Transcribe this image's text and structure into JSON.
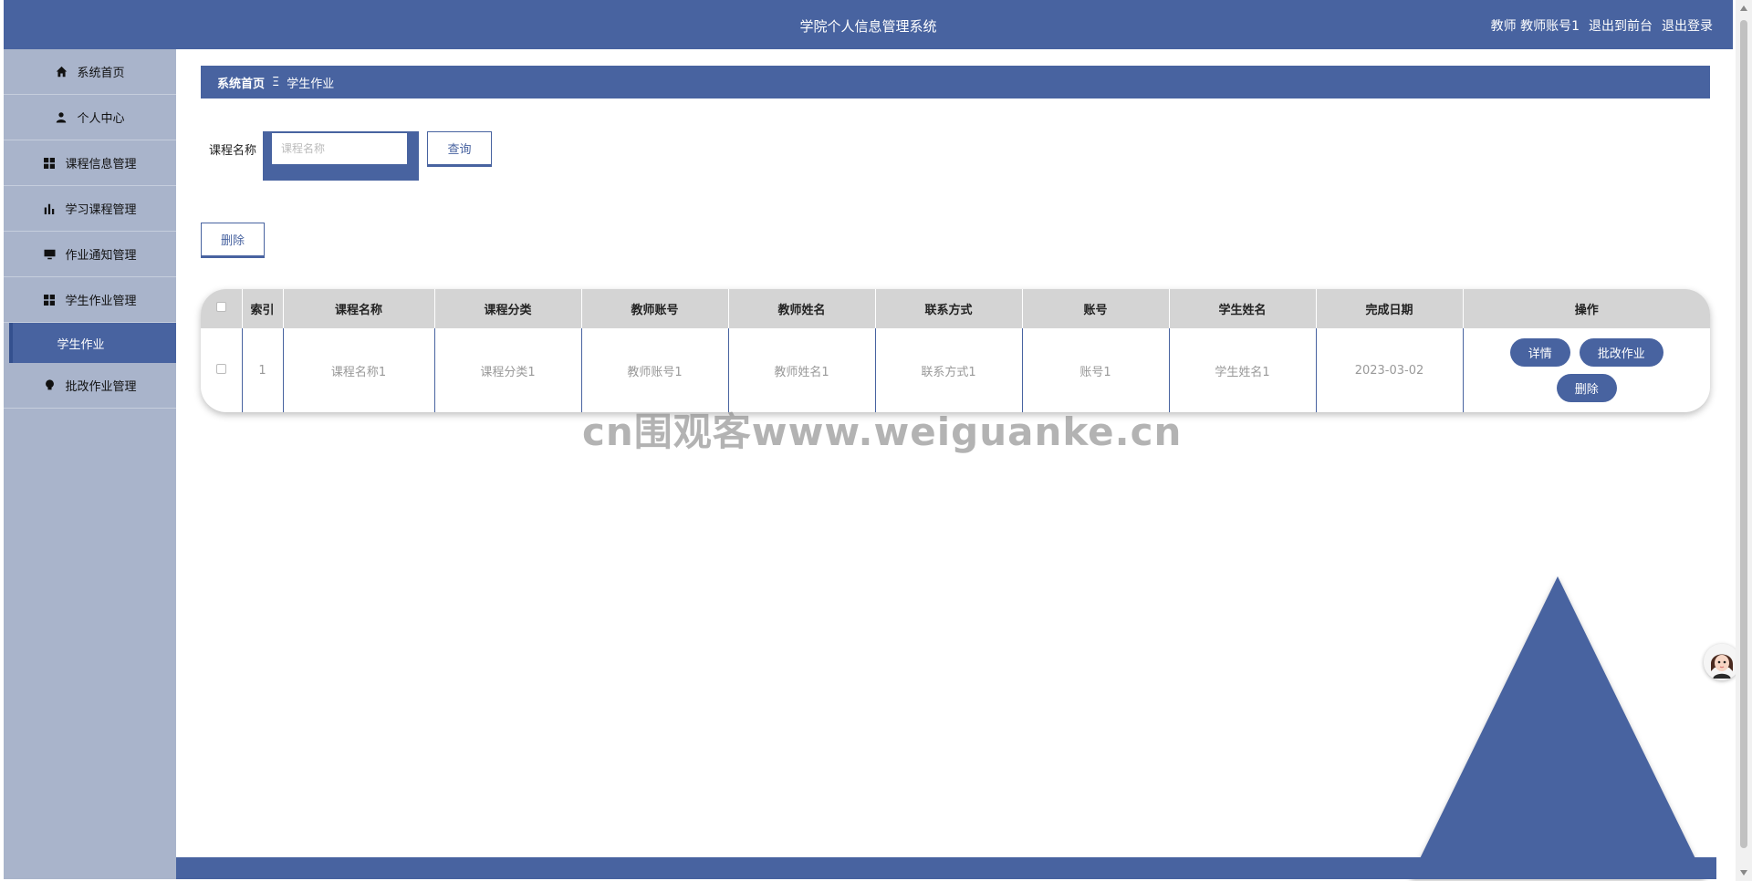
{
  "header": {
    "title": "学院个人信息管理系统",
    "user_info": "教师 教师账号1",
    "front_link": "退出到前台",
    "logout_link": "退出登录"
  },
  "sidebar": {
    "items": [
      {
        "label": "系统首页",
        "icon": "home-icon"
      },
      {
        "label": "个人中心",
        "icon": "user-icon"
      },
      {
        "label": "课程信息管理",
        "icon": "grid-icon"
      },
      {
        "label": "学习课程管理",
        "icon": "bar-chart-icon"
      },
      {
        "label": "作业通知管理",
        "icon": "monitor-icon"
      },
      {
        "label": "学生作业管理",
        "icon": "grid-icon"
      }
    ],
    "active_sub": "学生作业",
    "last_item": {
      "label": "批改作业管理",
      "icon": "bulb-icon"
    }
  },
  "breadcrumb": {
    "home": "系统首页",
    "separator": "Ξ",
    "current": "学生作业"
  },
  "search": {
    "label": "课程名称",
    "placeholder": "课程名称",
    "value": "",
    "query_button": "查询"
  },
  "toolbar": {
    "delete_button": "删除"
  },
  "table": {
    "headers": [
      "索引",
      "课程名称",
      "课程分类",
      "教师账号",
      "教师姓名",
      "联系方式",
      "账号",
      "学生姓名",
      "完成日期",
      "操作"
    ],
    "rows": [
      {
        "index": "1",
        "course_name": "课程名称1",
        "course_category": "课程分类1",
        "teacher_account": "教师账号1",
        "teacher_name": "教师姓名1",
        "contact": "联系方式1",
        "account": "账号1",
        "student_name": "学生姓名1",
        "finish_date": "2023-03-02",
        "actions": {
          "detail": "详情",
          "grade": "批改作业",
          "delete": "删除"
        }
      }
    ]
  },
  "watermark": "cn围观客www.weiguanke.cn",
  "colors": {
    "primary": "#4863a0",
    "sidebar_bg": "#a9b4cb",
    "table_header_bg": "#d4d4d4"
  }
}
